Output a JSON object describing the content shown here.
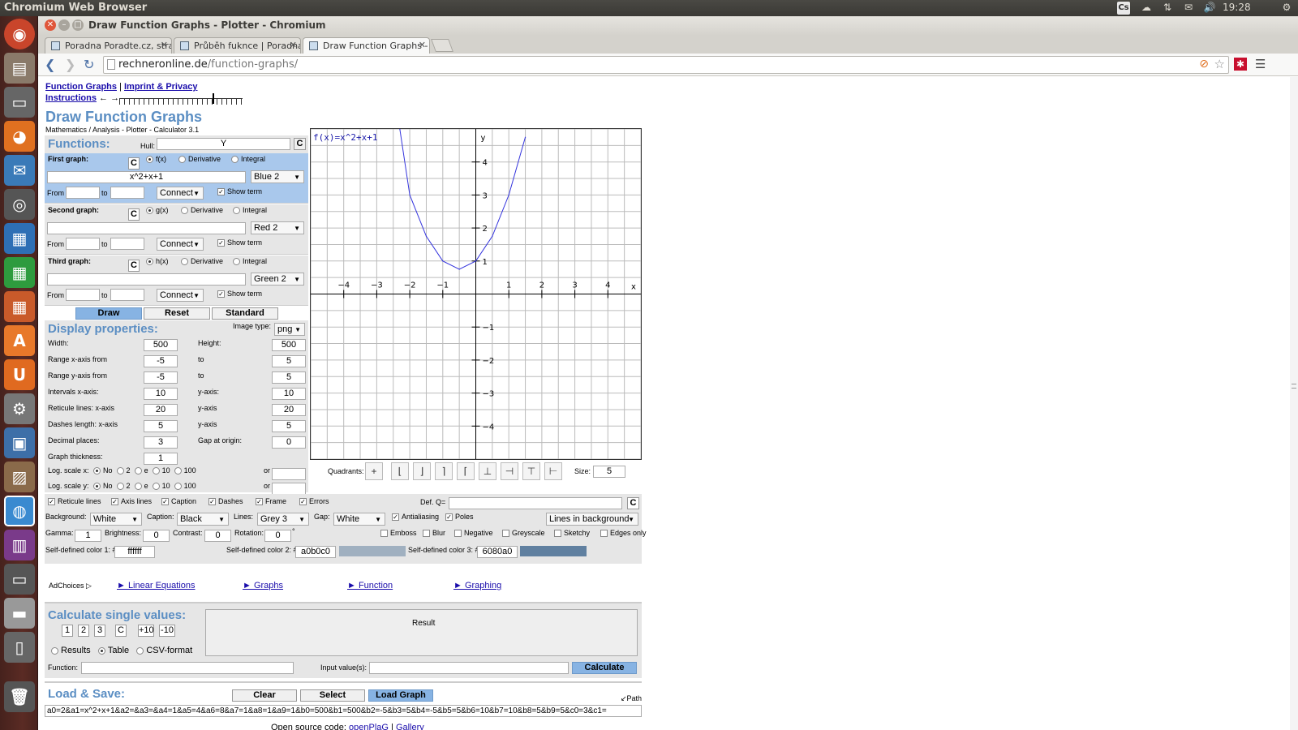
{
  "os": {
    "title": "Chromium Web Browser",
    "time": "19:28",
    "cs_badge": "Cs"
  },
  "window": {
    "title": "Draw Function Graphs - Plotter - Chromium"
  },
  "tabs": [
    {
      "label": "Poradna Poradte.cz, stran"
    },
    {
      "label": "Průběh fuknce | Poradna I"
    },
    {
      "label": "Draw Function Graphs - Pl"
    }
  ],
  "address": {
    "domain": "rechneronline.de",
    "path": "/function-graphs/"
  },
  "nav": {
    "link1": "Function Graphs",
    "sep": "|",
    "link2": "Imprint & Privacy",
    "instructions": "Instructions",
    "arrows": "← →"
  },
  "page": {
    "title": "Draw Function Graphs",
    "subtitle": "Mathematics / Analysis - Plotter - Calculator 3.1"
  },
  "functions": {
    "heading": "Functions:",
    "hull_label": "Hull:",
    "hull_value": "Y",
    "clear": "C"
  },
  "graphs": [
    {
      "label": "First graph:",
      "fname": "f(x)",
      "term": "x^2+x+1",
      "color": "Blue 2",
      "from": "",
      "to": "",
      "mode": "Connect",
      "show_term": "Show term"
    },
    {
      "label": "Second graph:",
      "fname": "g(x)",
      "term": "",
      "color": "Red 2",
      "from": "",
      "to": "",
      "mode": "Connect",
      "show_term": "Show term"
    },
    {
      "label": "Third graph:",
      "fname": "h(x)",
      "term": "",
      "color": "Green 2",
      "from": "",
      "to": "",
      "mode": "Connect",
      "show_term": "Show term"
    }
  ],
  "graph_common": {
    "derivative": "Derivative",
    "integral": "Integral",
    "from": "From",
    "to": "to",
    "clear": "C"
  },
  "actions": {
    "draw": "Draw",
    "reset": "Reset",
    "standard": "Standard"
  },
  "display": {
    "heading": "Display properties:",
    "image_type_label": "Image type:",
    "image_type": "png",
    "width_label": "Width:",
    "width": "500",
    "height_label": "Height:",
    "height": "500",
    "rx_label": "Range x-axis from",
    "rx_from": "-5",
    "rx_to": "5",
    "to": "to",
    "ry_label": "Range y-axis from",
    "ry_from": "-5",
    "ry_to": "5",
    "ix_label": "Intervals x-axis:",
    "ix": "10",
    "iy_label": "y-axis:",
    "iy": "10",
    "rl_label": "Reticule lines: x-axis",
    "rlx": "20",
    "rly_label": "y-axis",
    "rly": "20",
    "dl_label": "Dashes length: x-axis",
    "dlx": "5",
    "dly_label": "y-axis",
    "dly": "5",
    "dp_label": "Decimal places:",
    "dp": "3",
    "gap_label": "Gap at origin:",
    "gap": "0",
    "gt_label": "Graph thickness:",
    "gt": "1",
    "logx_label": "Log. scale x:",
    "logy_label": "Log. scale y:",
    "log_opts": [
      "No",
      "2",
      "e",
      "10",
      "100"
    ],
    "or": "or"
  },
  "plot": {
    "caption": "f(x)=x^2+x+1",
    "xlabel": "x",
    "ylabel": "y"
  },
  "chart_data": {
    "type": "line",
    "title": "f(x)=x^2+x+1",
    "xlabel": "x",
    "ylabel": "y",
    "xlim": [
      -5,
      5
    ],
    "ylim": [
      -5,
      5
    ],
    "grid": true,
    "series": [
      {
        "name": "f(x)=x^2+x+1",
        "color": "#3333dd",
        "x": [
          -2.3,
          -2,
          -1.5,
          -1,
          -0.5,
          0,
          0.5,
          1,
          1.5
        ],
        "y": [
          4.99,
          3,
          1.75,
          1,
          0.75,
          1,
          1.75,
          3,
          4.75
        ]
      }
    ],
    "xticks": [
      "−4",
      "−3",
      "−2",
      "−1",
      "1",
      "2",
      "3",
      "4"
    ],
    "yticks": [
      "4",
      "3",
      "2",
      "1",
      "−1",
      "−2",
      "−3",
      "−4"
    ]
  },
  "quadrants": {
    "label": "Quadrants:",
    "buttons": [
      "+",
      "⌊",
      "⌋",
      "⌉",
      "⌈",
      "⊥",
      "⊣",
      "⊤",
      "⊢"
    ],
    "size_label": "Size:",
    "size": "5"
  },
  "options": {
    "checks": [
      "Reticule lines",
      "Axis lines",
      "Caption",
      "Dashes",
      "Frame",
      "Errors"
    ],
    "defq_label": "Def. Q=",
    "defq_clear": "C",
    "bg_label": "Background:",
    "bg": "White",
    "cap_label": "Caption:",
    "cap": "Black",
    "lines_label": "Lines:",
    "lines": "Grey 3",
    "gap_label": "Gap:",
    "gap": "White",
    "antialias": "Antialiasing",
    "poles": "Poles",
    "lines_bg": "Lines in background",
    "gamma_label": "Gamma:",
    "gamma": "1",
    "bright_label": "Brightness:",
    "bright": "0",
    "contrast_label": "Contrast:",
    "contrast": "0",
    "rot_label": "Rotation:",
    "rot": "0",
    "deg": "°",
    "effects": [
      "Emboss",
      "Blur",
      "Negative",
      "Greyscale",
      "Sketchy",
      "Edges only"
    ],
    "c1_label": "Self-defined color 1: #",
    "c1": "ffffff",
    "c2_label": "Self-defined color 2: #",
    "c2": "a0b0c0",
    "c3_label": "Self-defined color 3: #",
    "c3": "6080a0",
    "c2_hex": "#a0b0c0",
    "c3_hex": "#6080a0"
  },
  "ads": {
    "label": "AdChoices ▷",
    "links": [
      "► Linear Equations",
      "► Graphs",
      "► Function",
      "► Graphing"
    ]
  },
  "calc": {
    "heading": "Calculate single values:",
    "btns": [
      "1",
      "2",
      "3",
      "C",
      "+10",
      "-10"
    ],
    "result": "Result",
    "modes": [
      "Results",
      "Table",
      "CSV-format"
    ],
    "function_label": "Function:",
    "input_label": "Input value(s):",
    "calculate": "Calculate"
  },
  "load": {
    "heading": "Load & Save:",
    "clear": "Clear",
    "select": "Select",
    "load": "Load Graph",
    "path": "↙Path",
    "url": "a0=2&a1=x^2+x+1&a2=&a3=&a4=1&a5=4&a6=8&a7=1&a8=1&a9=1&b0=500&b1=500&b2=-5&b3=5&b4=-5&b5=5&b6=10&b7=10&b8=5&b9=5&c0=3&c1="
  },
  "footer": {
    "text": "Open source code:",
    "link1": "openPlaG",
    "sep": "|",
    "link2": "Gallery"
  }
}
